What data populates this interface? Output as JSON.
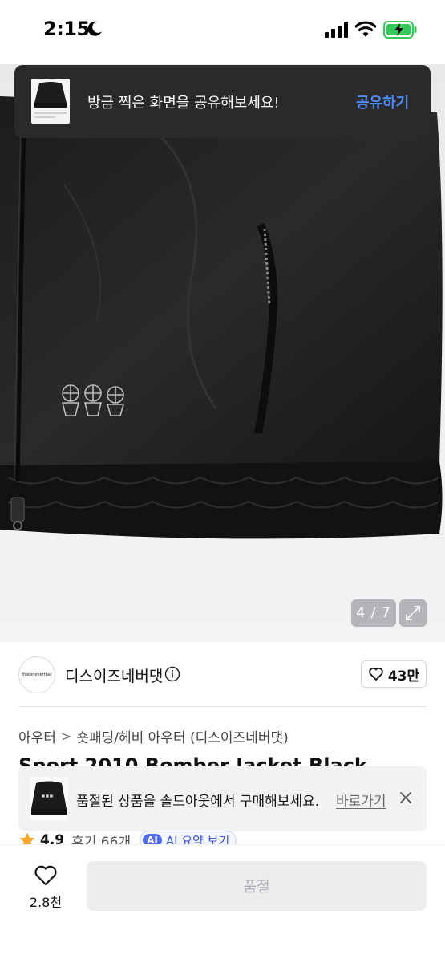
{
  "status_bar": {
    "time": "2:15"
  },
  "gallery": {
    "counter": "4 / 7"
  },
  "share_toast": {
    "message": "방금 찍은 화면을 공유해보세요!",
    "action": "공유하기",
    "accent_color": "#4d8cf5"
  },
  "brand": {
    "logo_text": "thisisneverthat",
    "name": "디스이즈네버댓",
    "like_count": "43만"
  },
  "breadcrumb": {
    "items": [
      "아우터",
      "숏패딩/헤비 아우터 (디스이즈네버댓)"
    ],
    "separator": ">"
  },
  "product": {
    "title": "Sport 2010 Bomber Jacket Black"
  },
  "rating": {
    "value": "4.9",
    "reviews": "후기 66개",
    "ai_badge": "AI",
    "ai_summary": "AI 요약 보기",
    "star_color": "#f5a623"
  },
  "soldout_toast": {
    "message": "품절된 상품을 솔드아웃에서 구매해보세요.",
    "link": "바로가기"
  },
  "bottom_bar": {
    "wish_count": "2.8천",
    "buy_label": "품절"
  }
}
